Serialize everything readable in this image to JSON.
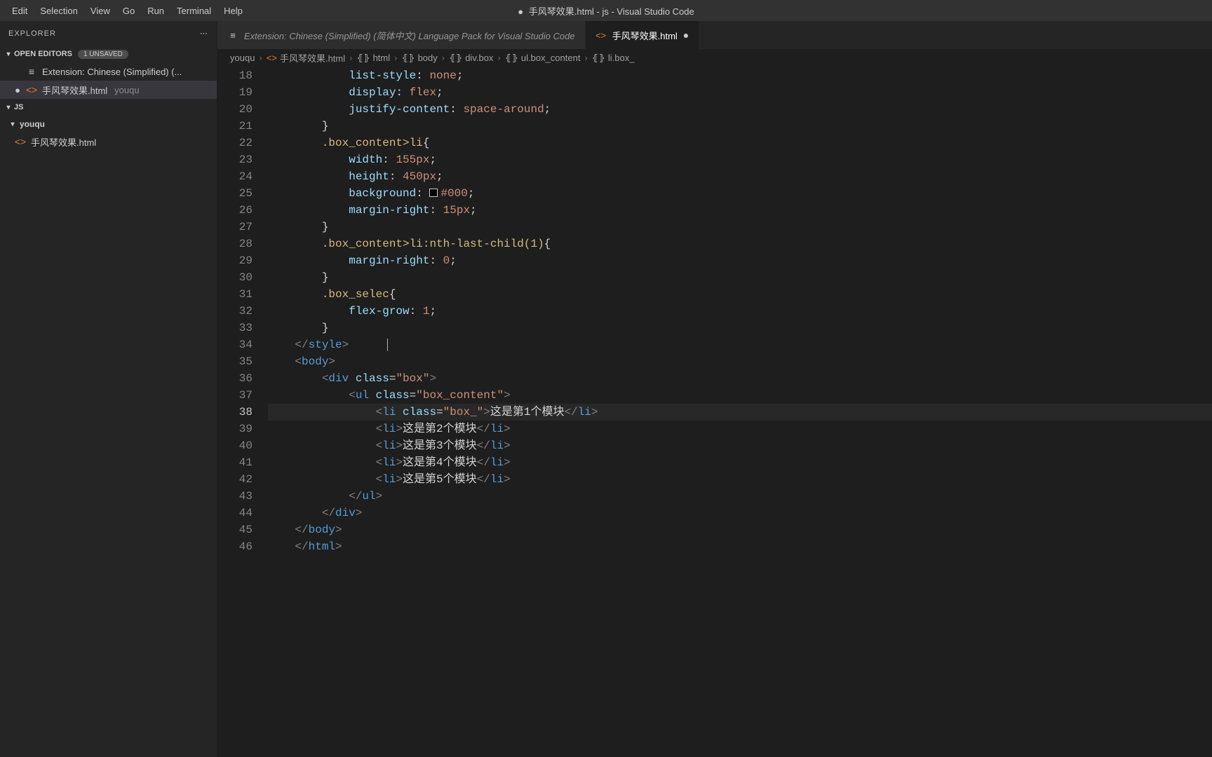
{
  "menubar": {
    "items": [
      "Edit",
      "Selection",
      "View",
      "Go",
      "Run",
      "Terminal",
      "Help"
    ]
  },
  "window": {
    "title_prefix": "●",
    "title": "手风琴效果.html - js - Visual Studio Code"
  },
  "sidebar": {
    "title": "EXPLORER",
    "open_editors": {
      "label": "OPEN EDITORS",
      "unsaved_badge": "1 UNSAVED",
      "items": [
        {
          "icon": "extension",
          "label": "Extension: Chinese (Simplified) (...",
          "modified": false
        },
        {
          "icon": "html",
          "label": "手风琴效果.html",
          "dim": "youqu",
          "modified": true
        }
      ]
    },
    "js_section": {
      "label": "JS"
    },
    "folder": {
      "name": "youqu",
      "expanded": true,
      "files": [
        {
          "icon": "html",
          "label": "手风琴效果.html"
        }
      ]
    }
  },
  "tabs": [
    {
      "icon": "extension",
      "label": "Extension: Chinese (Simplified) (简体中文) Language Pack for Visual Studio Code",
      "active": false,
      "italic": true
    },
    {
      "icon": "html",
      "label": "手风琴效果.html",
      "active": true,
      "modified": true
    }
  ],
  "breadcrumbs": [
    {
      "icon": "",
      "label": "youqu"
    },
    {
      "icon": "html",
      "label": "手风琴效果.html"
    },
    {
      "icon": "brackets",
      "label": "html"
    },
    {
      "icon": "brackets",
      "label": "body"
    },
    {
      "icon": "brackets",
      "label": "div.box"
    },
    {
      "icon": "brackets",
      "label": "ul.box_content"
    },
    {
      "icon": "brackets",
      "label": "li.box_"
    }
  ],
  "editor": {
    "first_line": 18,
    "active_line": 38,
    "lines": [
      {
        "n": 18,
        "kind": "css-decl",
        "indent": 3,
        "prop": "list-style",
        "val": "none"
      },
      {
        "n": 19,
        "kind": "css-decl",
        "indent": 3,
        "prop": "display",
        "val": "flex"
      },
      {
        "n": 20,
        "kind": "css-decl",
        "indent": 3,
        "prop": "justify-content",
        "val": "space-around"
      },
      {
        "n": 21,
        "kind": "css-close",
        "indent": 2
      },
      {
        "n": 22,
        "kind": "css-sel",
        "indent": 2,
        "sel": ".box_content>li"
      },
      {
        "n": 23,
        "kind": "css-decl",
        "indent": 3,
        "prop": "width",
        "val": "155px"
      },
      {
        "n": 24,
        "kind": "css-decl",
        "indent": 3,
        "prop": "height",
        "val": "450px"
      },
      {
        "n": 25,
        "kind": "css-decl-color",
        "indent": 3,
        "prop": "background",
        "val": "#000"
      },
      {
        "n": 26,
        "kind": "css-decl",
        "indent": 3,
        "prop": "margin-right",
        "val": "15px"
      },
      {
        "n": 27,
        "kind": "css-close",
        "indent": 2
      },
      {
        "n": 28,
        "kind": "css-sel",
        "indent": 2,
        "sel": ".box_content>li:nth-last-child(1)"
      },
      {
        "n": 29,
        "kind": "css-decl",
        "indent": 3,
        "prop": "margin-right",
        "val": "0"
      },
      {
        "n": 30,
        "kind": "css-close",
        "indent": 2
      },
      {
        "n": 31,
        "kind": "css-sel",
        "indent": 2,
        "sel": ".box_selec"
      },
      {
        "n": 32,
        "kind": "css-decl",
        "indent": 3,
        "prop": "flex-grow",
        "val": "1"
      },
      {
        "n": 33,
        "kind": "css-close",
        "indent": 2
      },
      {
        "n": 34,
        "kind": "close-tag",
        "indent": 1,
        "tag": "style"
      },
      {
        "n": 35,
        "kind": "open-tag",
        "indent": 1,
        "tag": "body"
      },
      {
        "n": 36,
        "kind": "open-tag-attr",
        "indent": 2,
        "tag": "div",
        "attr": "class",
        "val": "box"
      },
      {
        "n": 37,
        "kind": "open-tag-attr",
        "indent": 3,
        "tag": "ul",
        "attr": "class",
        "val": "box_content"
      },
      {
        "n": 38,
        "kind": "li-attr",
        "indent": 4,
        "tag": "li",
        "attr": "class",
        "val": "box_",
        "text": "这是第1个模块"
      },
      {
        "n": 39,
        "kind": "li",
        "indent": 4,
        "tag": "li",
        "text": "这是第2个模块"
      },
      {
        "n": 40,
        "kind": "li",
        "indent": 4,
        "tag": "li",
        "text": "这是第3个模块"
      },
      {
        "n": 41,
        "kind": "li",
        "indent": 4,
        "tag": "li",
        "text": "这是第4个模块"
      },
      {
        "n": 42,
        "kind": "li",
        "indent": 4,
        "tag": "li",
        "text": "这是第5个模块"
      },
      {
        "n": 43,
        "kind": "close-tag",
        "indent": 3,
        "tag": "ul"
      },
      {
        "n": 44,
        "kind": "close-tag",
        "indent": 2,
        "tag": "div"
      },
      {
        "n": 45,
        "kind": "close-tag",
        "indent": 1,
        "tag": "body"
      },
      {
        "n": 46,
        "kind": "close-tag",
        "indent": 1,
        "tag": "html"
      }
    ]
  }
}
